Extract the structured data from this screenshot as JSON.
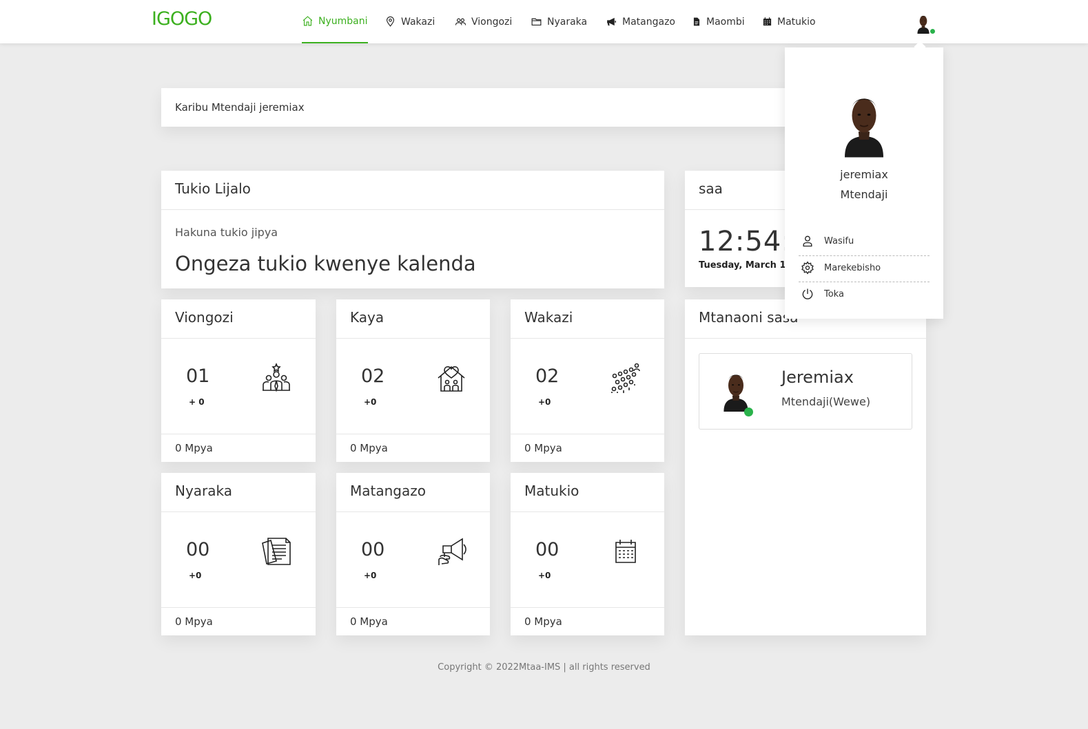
{
  "brand": "IGOGO",
  "nav": [
    {
      "label": "Nyumbani",
      "icon": "home-icon"
    },
    {
      "label": "Wakazi",
      "icon": "map-pin-icon"
    },
    {
      "label": "Viongozi",
      "icon": "users-icon"
    },
    {
      "label": "Nyaraka",
      "icon": "folder-icon"
    },
    {
      "label": "Matangazo",
      "icon": "bullhorn-icon"
    },
    {
      "label": "Maombi",
      "icon": "file-icon"
    },
    {
      "label": "Matukio",
      "icon": "calendar-icon"
    }
  ],
  "welcome": "Karibu Mtendaji jeremiax",
  "event_card": {
    "title": "Tukio Lijalo",
    "subtitle": "Hakuna tukio jipya",
    "message": "Ongeza tukio kwenye kalenda"
  },
  "clock_card": {
    "title": "saa",
    "time": "12:54:4",
    "date": "Tuesday, March 1"
  },
  "stats": [
    {
      "title": "Viongozi",
      "count": "01",
      "delta": "+ 0",
      "footer": "0 Mpya",
      "icon": "leader-group-icon"
    },
    {
      "title": "Kaya",
      "count": "02",
      "delta": "+0",
      "footer": "0 Mpya",
      "icon": "family-house-icon"
    },
    {
      "title": "Wakazi",
      "count": "02",
      "delta": "+0",
      "footer": "0 Mpya",
      "icon": "crowd-icon"
    },
    {
      "title": "Nyaraka",
      "count": "00",
      "delta": "+0",
      "footer": "0 Mpya",
      "icon": "documents-icon"
    },
    {
      "title": "Matangazo",
      "count": "00",
      "delta": "+0",
      "footer": "0 Mpya",
      "icon": "megaphone-icon"
    },
    {
      "title": "Matukio",
      "count": "00",
      "delta": "+0",
      "footer": "0 Mpya",
      "icon": "calendar-icon"
    }
  ],
  "online_card": {
    "title": "Mtanaoni sasa",
    "person_name": "Jeremiax",
    "person_role": "Mtendaji(Wewe)"
  },
  "footer": "Copyright © 2022Mtaa-IMS | all rights reserved",
  "dropdown": {
    "name": "jeremiax",
    "role": "Mtendaji",
    "items": [
      {
        "label": "Wasifu",
        "icon": "user-icon"
      },
      {
        "label": "Marekebisho",
        "icon": "gear-icon"
      },
      {
        "label": "Toka",
        "icon": "power-icon"
      }
    ]
  },
  "colors": {
    "accent": "#3cb01f",
    "online": "#2ab24b",
    "background": "#ececec"
  }
}
